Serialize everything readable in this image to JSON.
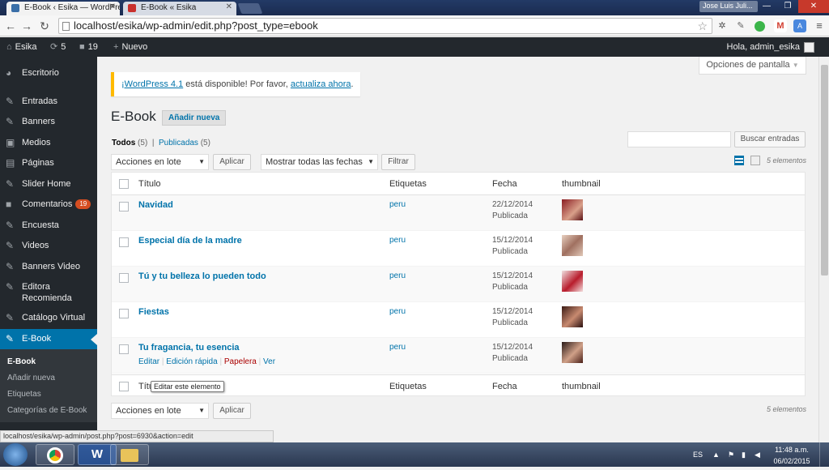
{
  "browser": {
    "tabs": [
      {
        "title": "E-Book ‹ Esika — WordPre"
      },
      {
        "title": "E-Book « Esika"
      }
    ],
    "user_chip": "Jose Luis Juli...",
    "url": "localhost/esika/wp-admin/edit.php?post_type=ebook",
    "status_url": "localhost/esika/wp-admin/post.php?post=6930&action=edit"
  },
  "adminbar": {
    "site": "Esika",
    "updates": "5",
    "comments": "19",
    "new": "Nuevo",
    "greeting": "Hola, admin_esika"
  },
  "sidebar": {
    "items": [
      {
        "label": "Escritorio",
        "icon": "dashboard-icon"
      },
      {
        "label": "Entradas",
        "icon": "pin-icon"
      },
      {
        "label": "Banners",
        "icon": "pin-icon"
      },
      {
        "label": "Medios",
        "icon": "media-icon"
      },
      {
        "label": "Páginas",
        "icon": "pages-icon"
      },
      {
        "label": "Slider Home",
        "icon": "pin-icon"
      },
      {
        "label": "Comentarios",
        "icon": "comment-icon",
        "badge": "19"
      },
      {
        "label": "Encuesta",
        "icon": "pin-icon"
      },
      {
        "label": "Videos",
        "icon": "pin-icon"
      },
      {
        "label": "Banners Video",
        "icon": "pin-icon"
      },
      {
        "label": "Editora Recomienda",
        "icon": "pin-icon"
      },
      {
        "label": "Catálogo Virtual",
        "icon": "pin-icon"
      },
      {
        "label": "E-Book",
        "icon": "pin-icon",
        "active": true
      }
    ],
    "submenu": [
      "E-Book",
      "Añadir nueva",
      "Etiquetas",
      "Categorías de E-Book"
    ]
  },
  "screen_options": "Opciones de pantalla",
  "notice": {
    "link1": "¡WordPress 4.1",
    "text": " está disponible! Por favor, ",
    "link2": "actualiza ahora",
    "end": "."
  },
  "page": {
    "title": "E-Book",
    "add_new": "Añadir nueva",
    "filter_all": "Todos",
    "filter_all_count": "(5)",
    "filter_sep": "|",
    "filter_published": "Publicadas",
    "filter_published_count": "(5)",
    "search_button": "Buscar entradas",
    "bulk_actions": "Acciones en lote",
    "apply": "Aplicar",
    "dates": "Mostrar todas las fechas",
    "filter": "Filtrar",
    "count": "5 elementos"
  },
  "table": {
    "columns": [
      "Título",
      "Etiquetas",
      "Fecha",
      "thumbnail"
    ],
    "rows": [
      {
        "title": "Navidad",
        "tag": "peru",
        "date": "22/12/2014",
        "status": "Publicada"
      },
      {
        "title": "Especial día de la madre",
        "tag": "peru",
        "date": "15/12/2014",
        "status": "Publicada"
      },
      {
        "title": "Tú y tu belleza lo pueden todo",
        "tag": "peru",
        "date": "15/12/2014",
        "status": "Publicada"
      },
      {
        "title": "Fiestas",
        "tag": "peru",
        "date": "15/12/2014",
        "status": "Publicada"
      },
      {
        "title": "Tu fragancia, tu esencia",
        "tag": "peru",
        "date": "15/12/2014",
        "status": "Publicada"
      }
    ],
    "row_actions": {
      "edit": "Editar",
      "quick": "Edición rápida",
      "trash": "Papelera",
      "view": "Ver",
      "sep": "|"
    },
    "footer_title": "Títu",
    "tooltip": "Editar este elemento"
  },
  "taskbar": {
    "lang": "ES",
    "time": "11:48 a.m.",
    "date": "06/02/2015",
    "word_label": "W"
  }
}
